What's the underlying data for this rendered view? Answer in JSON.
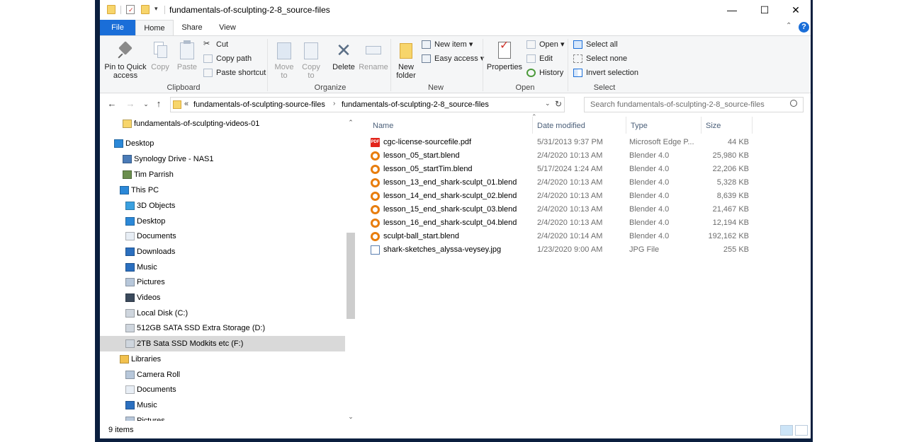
{
  "window": {
    "title": "fundamentals-of-sculpting-2-8_source-files",
    "controls": {
      "minimize": "—",
      "maximize": "☐",
      "close": "✕"
    }
  },
  "tabs": {
    "file": "File",
    "home": "Home",
    "share": "Share",
    "view": "View"
  },
  "ribbon": {
    "clipboard": {
      "label": "Clipboard",
      "pin": "Pin to Quick access",
      "copy": "Copy",
      "paste": "Paste",
      "cut": "Cut",
      "copy_path": "Copy path",
      "paste_shortcut": "Paste shortcut"
    },
    "organize": {
      "label": "Organize",
      "move_to": "Move to",
      "copy_to": "Copy to",
      "delete": "Delete",
      "rename": "Rename"
    },
    "new": {
      "label": "New",
      "new_folder": "New folder",
      "new_item": "New item",
      "easy_access": "Easy access"
    },
    "open": {
      "label": "Open",
      "properties": "Properties",
      "open": "Open",
      "edit": "Edit",
      "history": "History"
    },
    "select": {
      "label": "Select",
      "select_all": "Select all",
      "select_none": "Select none",
      "invert_selection": "Invert selection"
    }
  },
  "address": {
    "prefix": "«",
    "crumbs": [
      "fundamentals-of-sculpting-source-files",
      "fundamentals-of-sculpting-2-8_source-files"
    ],
    "search_placeholder": "Search fundamentals-of-sculpting-2-8_source-files"
  },
  "nav": {
    "items": [
      {
        "label": "fundamentals-of-sculpting-videos-01",
        "icon": "folder-icon"
      },
      {
        "label": "Desktop",
        "icon": "desktop-icon"
      },
      {
        "label": "Synology Drive - NAS1",
        "icon": "drive-icon"
      },
      {
        "label": "Tim Parrish",
        "icon": "user-icon"
      },
      {
        "label": "This PC",
        "icon": "computer-icon"
      },
      {
        "label": "3D Objects",
        "icon": "cube-icon"
      },
      {
        "label": "Desktop",
        "icon": "desktop-icon"
      },
      {
        "label": "Documents",
        "icon": "document-icon"
      },
      {
        "label": "Downloads",
        "icon": "download-icon"
      },
      {
        "label": "Music",
        "icon": "music-icon"
      },
      {
        "label": "Pictures",
        "icon": "picture-icon"
      },
      {
        "label": "Videos",
        "icon": "video-icon"
      },
      {
        "label": "Local Disk (C:)",
        "icon": "disk-icon"
      },
      {
        "label": "512GB SATA SSD Extra Storage (D:)",
        "icon": "disk-icon"
      },
      {
        "label": "2TB Sata SSD Modkits etc  (F:)",
        "icon": "disk-icon"
      },
      {
        "label": "Libraries",
        "icon": "library-icon"
      },
      {
        "label": "Camera Roll",
        "icon": "picture-icon"
      },
      {
        "label": "Documents",
        "icon": "document-icon"
      },
      {
        "label": "Music",
        "icon": "music-icon"
      },
      {
        "label": "Pictures",
        "icon": "picture-icon"
      }
    ]
  },
  "columns": {
    "name": "Name",
    "date": "Date modified",
    "type": "Type",
    "size": "Size"
  },
  "files": [
    {
      "name": "cgc-license-sourcefile.pdf",
      "date": "5/31/2013 9:37 PM",
      "type": "Microsoft Edge P...",
      "size": "44 KB",
      "icon": "pdf"
    },
    {
      "name": "lesson_05_start.blend",
      "date": "2/4/2020 10:13 AM",
      "type": "Blender 4.0",
      "size": "25,980 KB",
      "icon": "blend"
    },
    {
      "name": "lesson_05_startTim.blend",
      "date": "5/17/2024 1:24 AM",
      "type": "Blender 4.0",
      "size": "22,206 KB",
      "icon": "blend"
    },
    {
      "name": "lesson_13_end_shark-sculpt_01.blend",
      "date": "2/4/2020 10:13 AM",
      "type": "Blender 4.0",
      "size": "5,328 KB",
      "icon": "blend"
    },
    {
      "name": "lesson_14_end_shark-sculpt_02.blend",
      "date": "2/4/2020 10:13 AM",
      "type": "Blender 4.0",
      "size": "8,639 KB",
      "icon": "blend"
    },
    {
      "name": "lesson_15_end_shark-sculpt_03.blend",
      "date": "2/4/2020 10:13 AM",
      "type": "Blender 4.0",
      "size": "21,467 KB",
      "icon": "blend"
    },
    {
      "name": "lesson_16_end_shark-sculpt_04.blend",
      "date": "2/4/2020 10:13 AM",
      "type": "Blender 4.0",
      "size": "12,194 KB",
      "icon": "blend"
    },
    {
      "name": "sculpt-ball_start.blend",
      "date": "2/4/2020 10:14 AM",
      "type": "Blender 4.0",
      "size": "192,162 KB",
      "icon": "blend"
    },
    {
      "name": "shark-sketches_alyssa-veysey.jpg",
      "date": "1/23/2020 9:00 AM",
      "type": "JPG File",
      "size": "255 KB",
      "icon": "jpg"
    }
  ],
  "status": {
    "count": "9 items"
  },
  "colors": {
    "accent": "#1a6ed8",
    "frame": "#0b1f3f",
    "selected": "#d9d9d9"
  }
}
